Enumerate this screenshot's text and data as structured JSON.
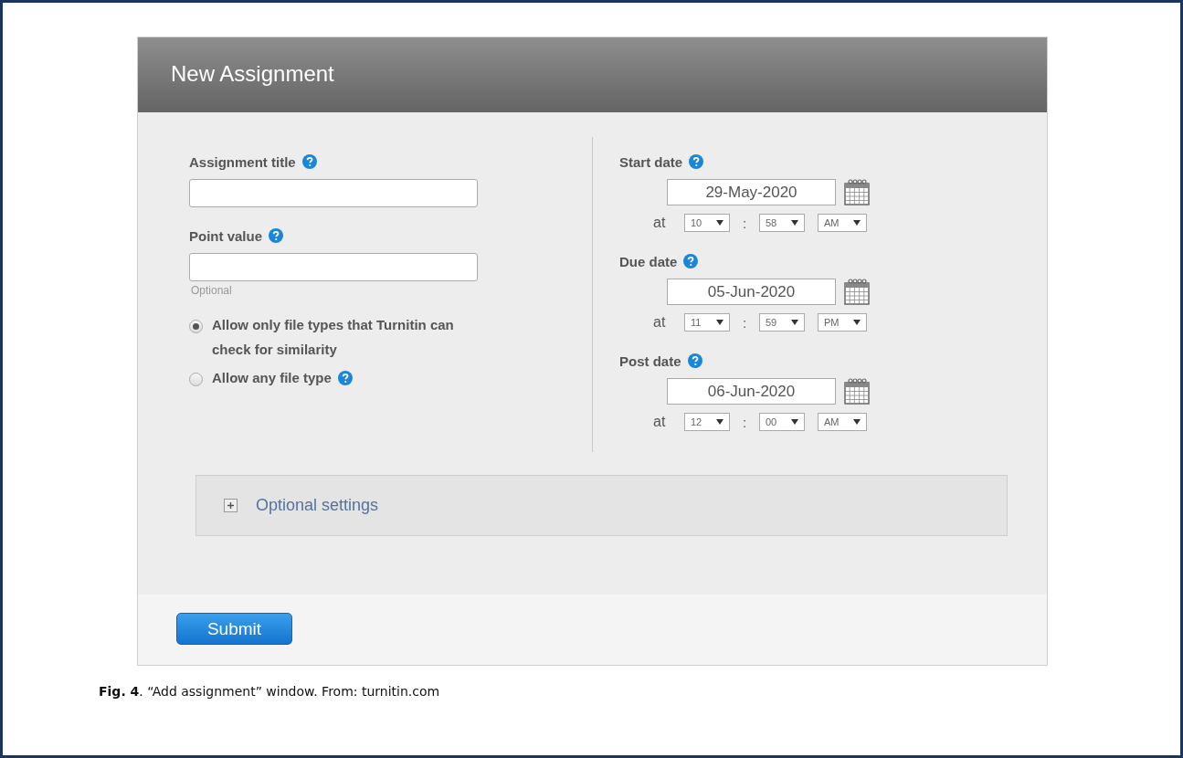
{
  "dialog": {
    "title": "New Assignment",
    "fields": [
      {
        "label": "Assignment title"
      },
      {
        "label": "Point value",
        "hint": "Optional"
      }
    ],
    "file_type_options": [
      {
        "label": "Allow only file types that Turnitin can check for similarity",
        "selected": true,
        "help": false
      },
      {
        "label": "Allow any file type",
        "selected": false,
        "help": true
      }
    ],
    "dates": [
      {
        "label": "Start date",
        "date": "29-May-2020",
        "at": "at",
        "hour": "10",
        "separator": ":",
        "minute": "58",
        "period": "AM"
      },
      {
        "label": "Due date",
        "date": "05-Jun-2020",
        "at": "at",
        "hour": "11",
        "separator": ":",
        "minute": "59",
        "period": "PM"
      },
      {
        "label": "Post date",
        "date": "06-Jun-2020",
        "at": "at",
        "hour": "12",
        "separator": ":",
        "minute": "00",
        "period": "AM"
      }
    ],
    "optional_settings": {
      "label": "Optional settings",
      "expanded": false
    },
    "submit_button": "Submit"
  },
  "caption": "**Fig. 4**. “Add assignment” window. From: turnitin.com"
}
